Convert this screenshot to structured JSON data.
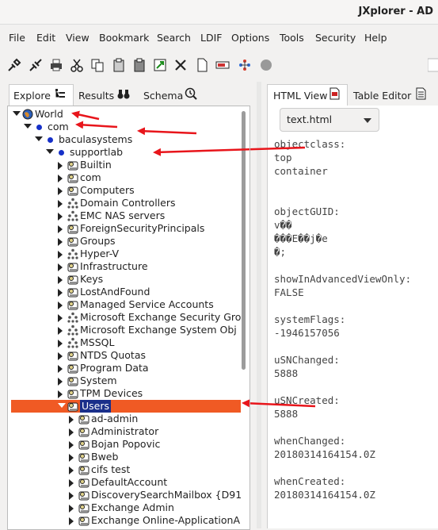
{
  "window": {
    "title": "JXplorer - AD"
  },
  "menu": [
    "File",
    "Edit",
    "View",
    "Bookmark",
    "Search",
    "LDIF",
    "Options",
    "Tools",
    "Security",
    "Help"
  ],
  "toolbar_icons": [
    "connect-icon",
    "disconnect-icon",
    "print-icon",
    "cut-icon",
    "copy-icon",
    "paste-icon",
    "paste-alias-icon",
    "delete-icon",
    "new-icon",
    "rename-icon",
    "refresh-icon",
    "stop-icon"
  ],
  "left_tabs": [
    "Explore",
    "Results",
    "Schema"
  ],
  "right_tabs": [
    "HTML View",
    "Table Editor"
  ],
  "view_select": {
    "value": "text.html"
  },
  "tree": [
    {
      "label": "World",
      "depth": 0,
      "expanded": true,
      "icon": "globe-icon"
    },
    {
      "label": "com",
      "depth": 1,
      "expanded": true,
      "icon": "dot-icon"
    },
    {
      "label": "baculasystems",
      "depth": 2,
      "expanded": true,
      "icon": "dot-icon"
    },
    {
      "label": "supportlab",
      "depth": 3,
      "expanded": true,
      "icon": "dot-icon"
    },
    {
      "label": "Builtin",
      "depth": 4,
      "expanded": false,
      "icon": "container-icon"
    },
    {
      "label": "com",
      "depth": 4,
      "expanded": false,
      "icon": "container-icon"
    },
    {
      "label": "Computers",
      "depth": 4,
      "expanded": false,
      "icon": "container-icon"
    },
    {
      "label": "Domain Controllers",
      "depth": 4,
      "expanded": false,
      "icon": "ou-icon"
    },
    {
      "label": "EMC NAS servers",
      "depth": 4,
      "expanded": false,
      "icon": "ou-icon"
    },
    {
      "label": "ForeignSecurityPrincipals",
      "depth": 4,
      "expanded": false,
      "icon": "container-icon"
    },
    {
      "label": "Groups",
      "depth": 4,
      "expanded": false,
      "icon": "container-icon"
    },
    {
      "label": "Hyper-V",
      "depth": 4,
      "expanded": false,
      "icon": "ou-icon"
    },
    {
      "label": "Infrastructure",
      "depth": 4,
      "expanded": false,
      "icon": "container-icon"
    },
    {
      "label": "Keys",
      "depth": 4,
      "expanded": false,
      "icon": "container-icon"
    },
    {
      "label": "LostAndFound",
      "depth": 4,
      "expanded": false,
      "icon": "container-icon"
    },
    {
      "label": "Managed Service Accounts",
      "depth": 4,
      "expanded": false,
      "icon": "container-icon"
    },
    {
      "label": "Microsoft Exchange Security Gro",
      "depth": 4,
      "expanded": false,
      "icon": "ou-icon"
    },
    {
      "label": "Microsoft Exchange System Obj",
      "depth": 4,
      "expanded": false,
      "icon": "ou-icon"
    },
    {
      "label": "MSSQL",
      "depth": 4,
      "expanded": false,
      "icon": "ou-icon"
    },
    {
      "label": "NTDS Quotas",
      "depth": 4,
      "expanded": false,
      "icon": "container-icon"
    },
    {
      "label": "Program Data",
      "depth": 4,
      "expanded": false,
      "icon": "container-icon"
    },
    {
      "label": "System",
      "depth": 4,
      "expanded": false,
      "icon": "container-icon"
    },
    {
      "label": "TPM Devices",
      "depth": 4,
      "expanded": false,
      "icon": "container-icon"
    },
    {
      "label": "Users",
      "depth": 4,
      "expanded": true,
      "icon": "container-icon",
      "selected": true
    },
    {
      "label": "ad-admin",
      "depth": 5,
      "expanded": false,
      "icon": "container-icon"
    },
    {
      "label": "Administrator",
      "depth": 5,
      "expanded": false,
      "icon": "container-icon"
    },
    {
      "label": "Bojan Popovic",
      "depth": 5,
      "expanded": false,
      "icon": "container-icon"
    },
    {
      "label": "Bweb",
      "depth": 5,
      "expanded": false,
      "icon": "container-icon"
    },
    {
      "label": "cifs test",
      "depth": 5,
      "expanded": false,
      "icon": "container-icon"
    },
    {
      "label": "DefaultAccount",
      "depth": 5,
      "expanded": false,
      "icon": "container-icon"
    },
    {
      "label": "DiscoverySearchMailbox {D91",
      "depth": 5,
      "expanded": false,
      "icon": "container-icon"
    },
    {
      "label": "Exchange Admin",
      "depth": 5,
      "expanded": false,
      "icon": "container-icon"
    },
    {
      "label": "Exchange Online-ApplicationA",
      "depth": 5,
      "expanded": false,
      "icon": "container-icon"
    }
  ],
  "attribute_text": "objectclass:\ntop\ncontainer\n\n\nobjectGUID:\nv��\n���E��j�e\n�;\n\nshowInAdvancedViewOnly:\nFALSE\n\nsystemFlags:\n-1946157056\n\nuSNChanged:\n5888\n\nuSNCreated:\n5888\n\nwhenChanged:\n20180314164154.0Z\n\nwhenCreated:\n20180314164154.0Z",
  "colors": {
    "selection": "#f05a24",
    "annotation_arrow": "#e8151b",
    "dot": "#1630c8"
  }
}
